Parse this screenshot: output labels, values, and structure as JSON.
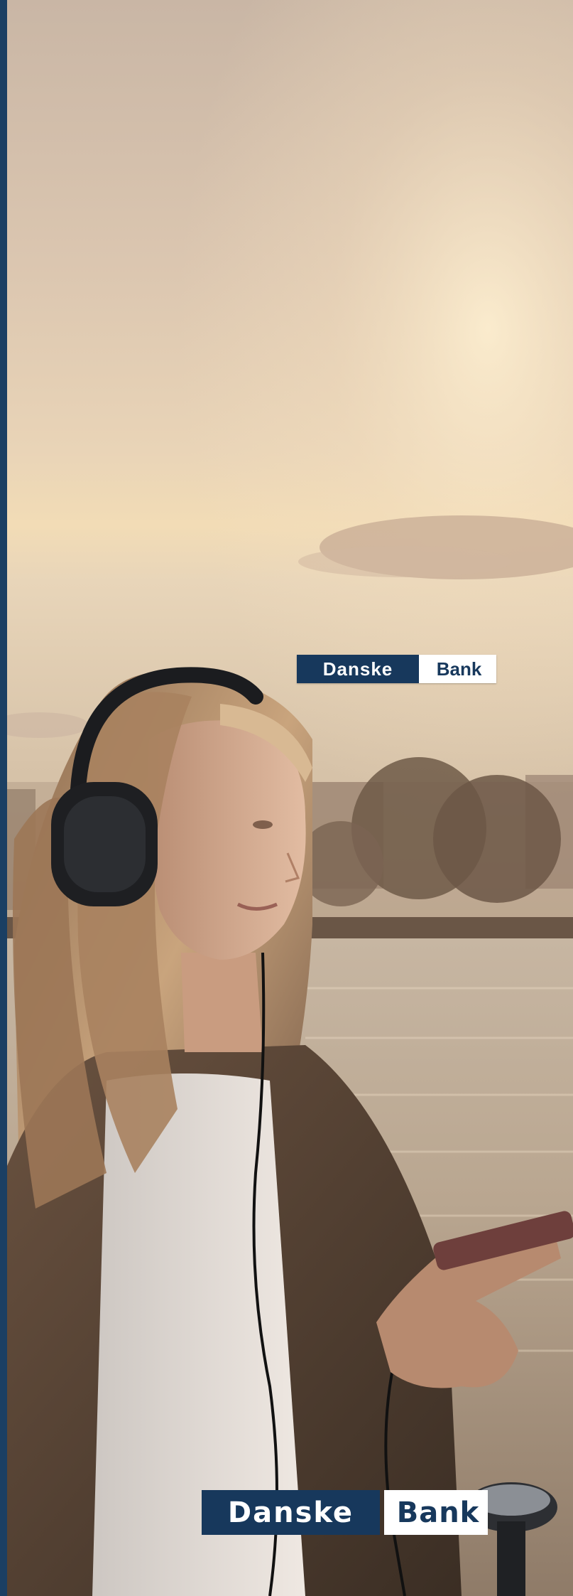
{
  "brand": {
    "name_left": "Danske",
    "name_right": "Bank",
    "primary_color": "#17385c",
    "secondary_color": "#ffffff"
  },
  "hero": {
    "icon": "person-with-headphones-photo",
    "accent_color": "#1b3f63"
  }
}
